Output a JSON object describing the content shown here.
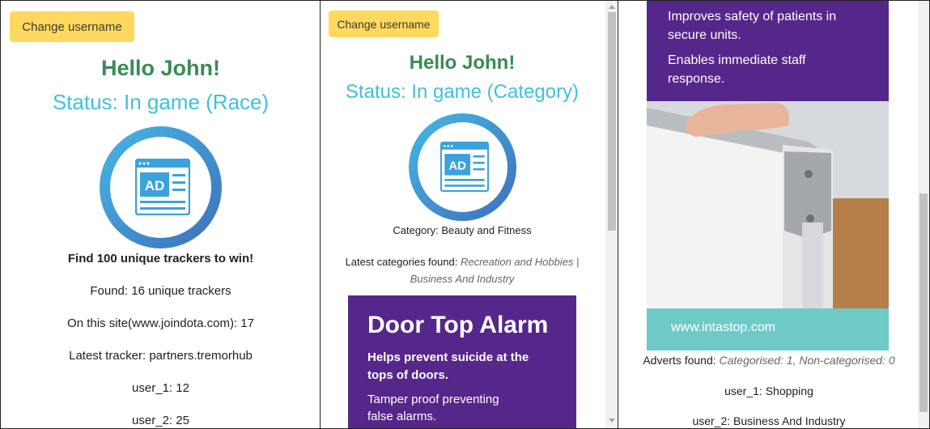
{
  "panel1": {
    "change_username": "Change username",
    "hello": "Hello John!",
    "status": "Status: In game (Race)",
    "goal": "Find 100 unique trackers to win!",
    "found": "Found: 16 unique trackers",
    "on_site": "On this site(www.joindota.com): 17",
    "latest_tracker": "Latest tracker: partners.tremorhub",
    "user1": "user_1: 12",
    "user2": "user_2: 25",
    "ad_icon_text": "AD"
  },
  "panel2": {
    "change_username": "Change username",
    "hello": "Hello John!",
    "status": "Status: In game (Category)",
    "ad_icon_text": "AD",
    "category": "Category: Beauty and Fitness",
    "latest_label": "Latest categories found:",
    "latest_value_1": "Recreation and Hobbies |",
    "latest_value_2": "Business And Industry",
    "ad_banner": {
      "title": "Door Top Alarm",
      "line1": "Helps prevent suicide at the",
      "line2": "tops of doors.",
      "line3": "Tamper proof preventing",
      "line4": "false alarms."
    }
  },
  "panel3": {
    "ad": {
      "line1": "Improves safety of patients in",
      "line2": "secure units.",
      "line3": "Enables immediate staff",
      "line4": "response.",
      "url": "www.intastop.com"
    },
    "adverts_label": "Adverts found:",
    "adverts_value": "Categorised: 1, Non-categorised: 0",
    "user1": "user_1: Shopping",
    "user2": "user_2: Business And Industry"
  },
  "colors": {
    "hello_green": "#3a8a55",
    "status_cyan": "#40c0dc",
    "button_yellow": "#ffd85e",
    "ad_purple": "#56278a",
    "ad_teal": "#6ecac7"
  }
}
